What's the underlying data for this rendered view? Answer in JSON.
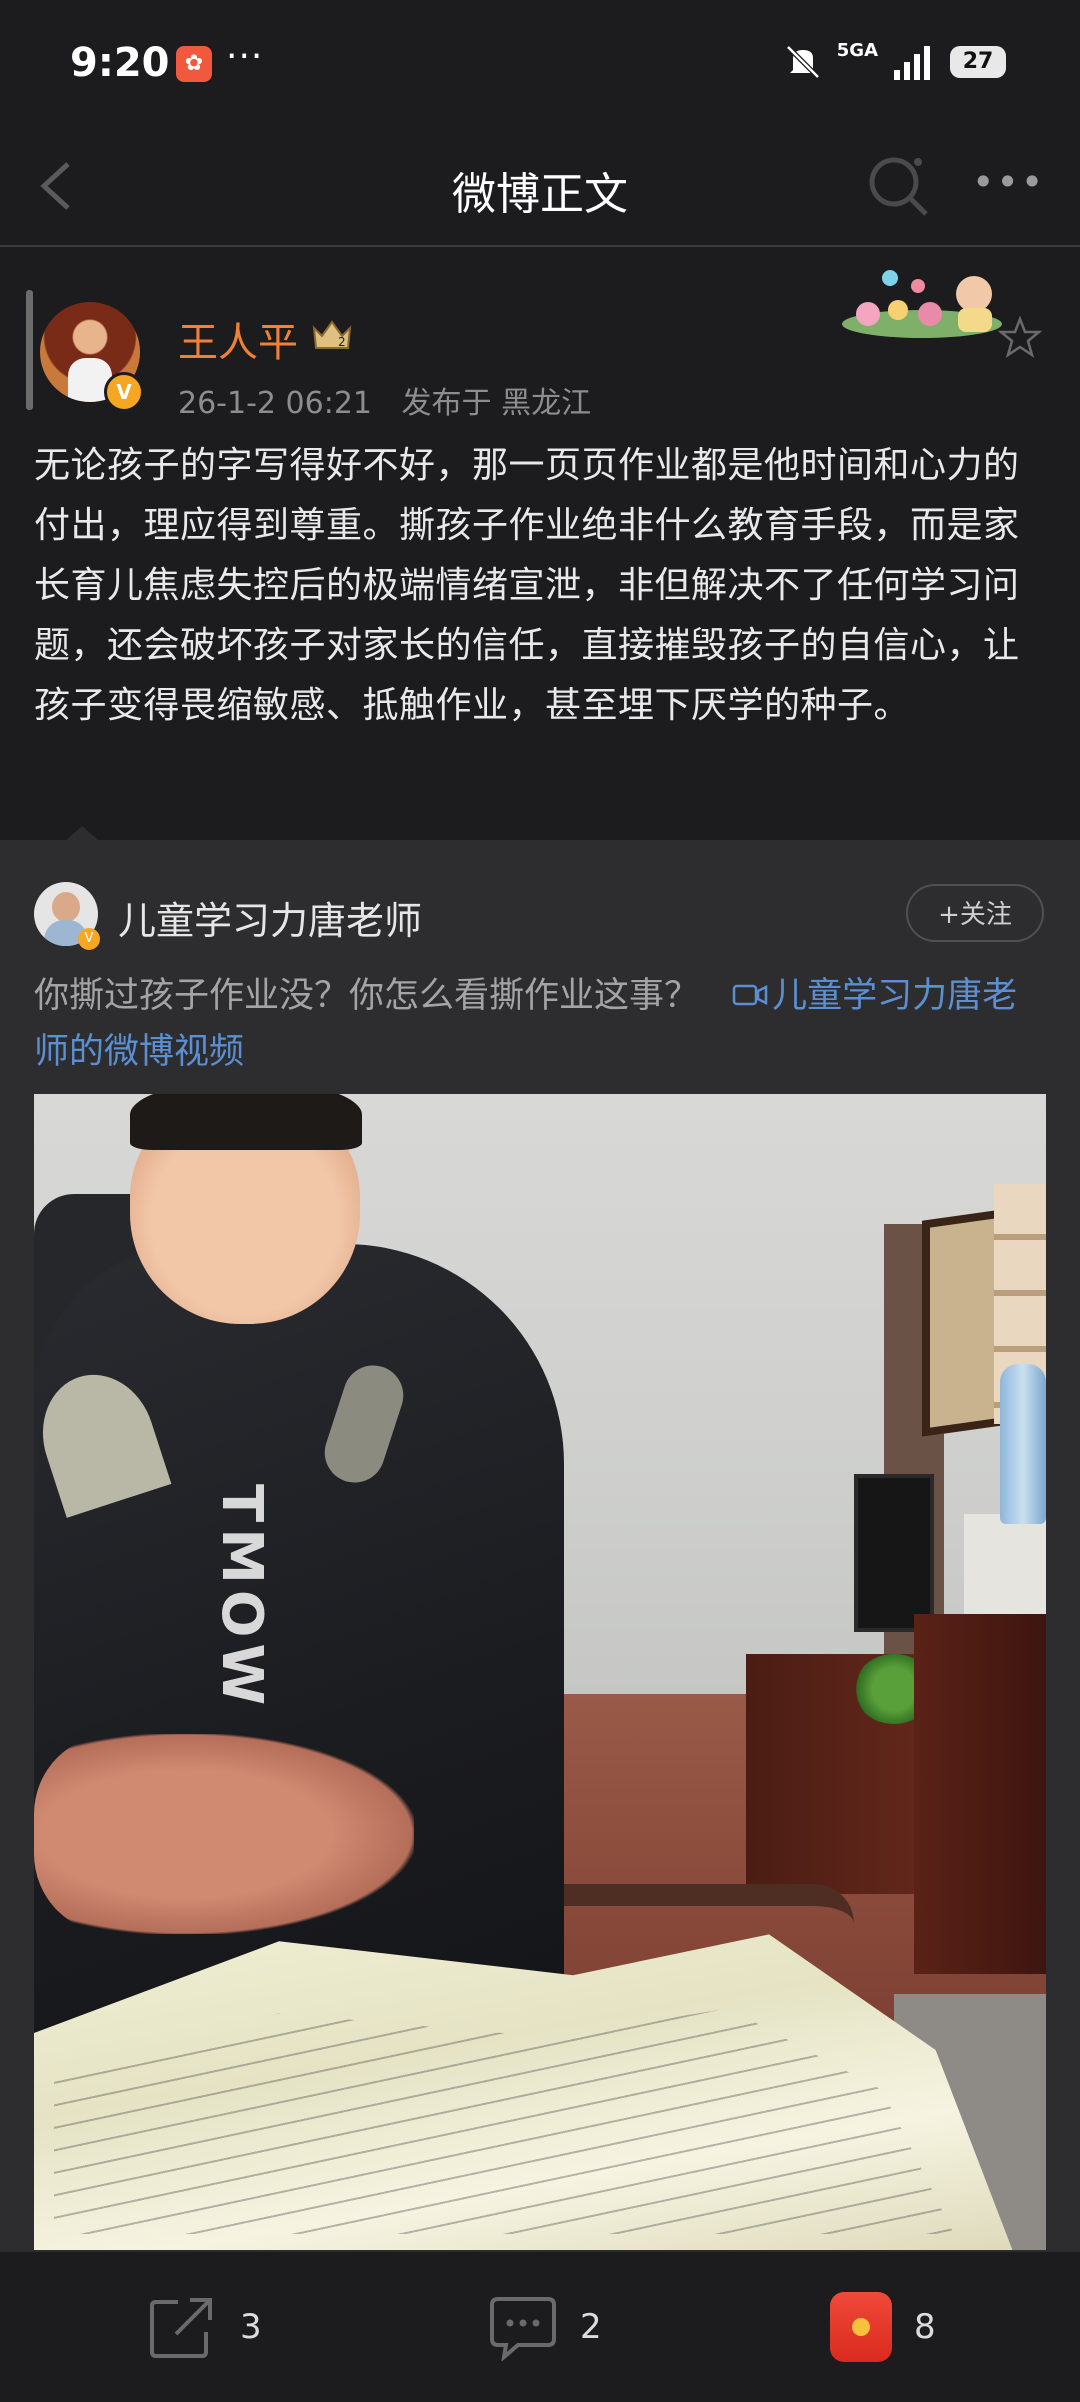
{
  "status_bar": {
    "time": "9:20",
    "app_badge_icon": "baidu-app-icon",
    "network_label": "5GA",
    "battery_level": "27"
  },
  "nav": {
    "title": "微博正文"
  },
  "post": {
    "author_name": "王人平",
    "level_badge": "2",
    "timestamp": "26-1-2 06:21",
    "location": "发布于 黑龙江",
    "text": "无论孩子的字写得好不好，那一页页作业都是他时间和心力的付出，理应得到尊重。撕孩子作业绝非什么教育手段，而是家长育儿焦虑失控后的极端情绪宣泄，非但解决不了任何学习问题，还会破坏孩子对家长的信任，直接摧毁孩子的自信心，让孩子变得畏缩敏感、抵触作业，甚至埋下厌学的种子。"
  },
  "repost": {
    "author_name": "儿童学习力唐老师",
    "follow_label": "+关注",
    "text": "你撕过孩子作业没？你怎么看撕作业这事？",
    "link_text": "儿童学习力唐老师的微博视频",
    "video_shirt_text": "TMOW"
  },
  "actions": {
    "repost_count": "3",
    "comment_count": "2",
    "like_count": "8"
  },
  "colors": {
    "background": "#1c1c1e",
    "author_name": "#f08136",
    "link": "#5b8fd2",
    "repost_bg": "#2d2d2f"
  }
}
